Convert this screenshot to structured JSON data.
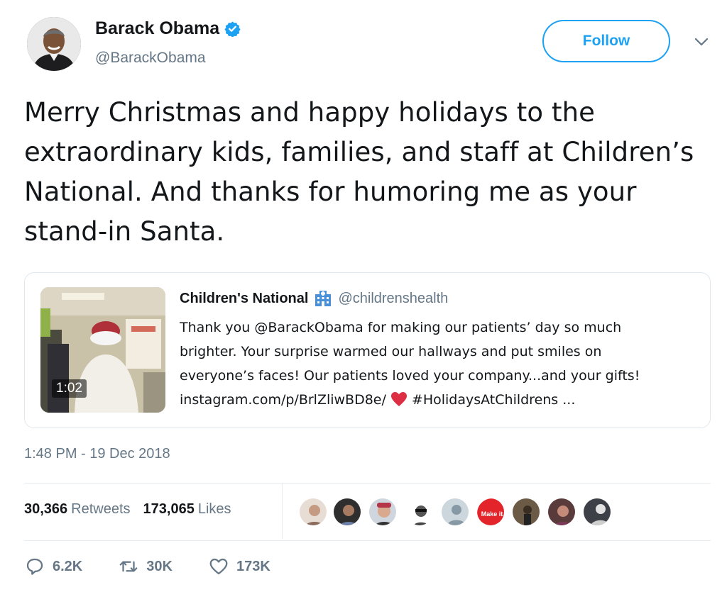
{
  "author": {
    "name": "Barack Obama",
    "handle": "@BarackObama",
    "verified_icon": "verified-badge-icon",
    "follow_label": "Follow"
  },
  "tweet": {
    "text": "Merry Christmas and happy holidays to the extraordinary kids, families, and staff at Children’s National. And thanks for humoring me as your stand-in Santa.",
    "timestamp": "1:48 PM - 19 Dec 2018"
  },
  "quoted": {
    "name": "Children's National",
    "handle": "@childrenshealth",
    "video_duration": "1:02",
    "lines": [
      "Thank you @BarackObama for making our patients’ day so much",
      "brighter. Your surprise warmed our hallways and put smiles on",
      "everyone’s faces! Our patients loved your company...and your gifts!"
    ],
    "link": "instagram.com/p/BrlZliwBD8e/",
    "hashtag": "#HolidaysAtChildrens ..."
  },
  "stats": {
    "retweets_count": "30,366",
    "retweets_label": "Retweets",
    "likes_count": "173,065",
    "likes_label": "Likes"
  },
  "actions": {
    "replies": "6.2K",
    "retweets": "30K",
    "likes": "173K"
  },
  "colors": {
    "accent": "#1da1f2",
    "muted": "#657786",
    "heart": "#e0245e"
  }
}
